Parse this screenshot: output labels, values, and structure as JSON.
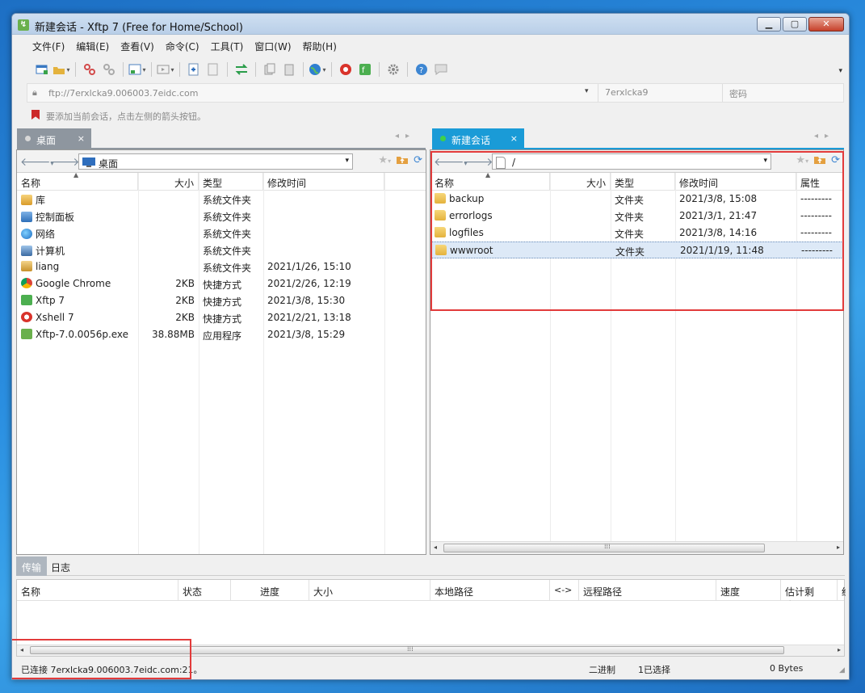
{
  "window": {
    "title": "新建会话 - Xftp 7 (Free for Home/School)",
    "minimize": "▭",
    "maximize": "▢",
    "close": "✕"
  },
  "menu": [
    "文件(F)",
    "编辑(E)",
    "查看(V)",
    "命令(C)",
    "工具(T)",
    "窗口(W)",
    "帮助(H)"
  ],
  "address": {
    "host": "ftp://7erxlcka9.006003.7eidc.com",
    "user": "7erxlcka9",
    "password": "密码"
  },
  "hint": "要添加当前会话，点击左侧的箭头按钮。",
  "left": {
    "tab": "桌面",
    "path": "桌面",
    "columns": [
      "名称",
      "大小",
      "类型",
      "修改时间"
    ],
    "rows": [
      {
        "icon": "library-icon",
        "name": "库",
        "size": "",
        "type": "系统文件夹",
        "modified": ""
      },
      {
        "icon": "control-panel-icon",
        "name": "控制面板",
        "size": "",
        "type": "系统文件夹",
        "modified": ""
      },
      {
        "icon": "network-icon",
        "name": "网络",
        "size": "",
        "type": "系统文件夹",
        "modified": ""
      },
      {
        "icon": "computer-icon",
        "name": "计算机",
        "size": "",
        "type": "系统文件夹",
        "modified": ""
      },
      {
        "icon": "user-folder-icon",
        "name": "liang",
        "size": "",
        "type": "系统文件夹",
        "modified": "2021/1/26, 15:10"
      },
      {
        "icon": "chrome-icon",
        "name": "Google Chrome",
        "size": "2KB",
        "type": "快捷方式",
        "modified": "2021/2/26, 12:19"
      },
      {
        "icon": "xftp-icon",
        "name": "Xftp 7",
        "size": "2KB",
        "type": "快捷方式",
        "modified": "2021/3/8, 15:30"
      },
      {
        "icon": "xshell-icon",
        "name": "Xshell 7",
        "size": "2KB",
        "type": "快捷方式",
        "modified": "2021/2/21, 13:18"
      },
      {
        "icon": "exe-icon",
        "name": "Xftp-7.0.0056p.exe",
        "size": "38.88MB",
        "type": "应用程序",
        "modified": "2021/3/8, 15:29"
      }
    ]
  },
  "right": {
    "tab": "新建会话",
    "path": "/",
    "columns": [
      "名称",
      "大小",
      "类型",
      "修改时间",
      "属性"
    ],
    "rows": [
      {
        "name": "backup",
        "size": "",
        "type": "文件夹",
        "modified": "2021/3/8, 15:08",
        "attr": "---------"
      },
      {
        "name": "errorlogs",
        "size": "",
        "type": "文件夹",
        "modified": "2021/3/1, 21:47",
        "attr": "---------"
      },
      {
        "name": "logfiles",
        "size": "",
        "type": "文件夹",
        "modified": "2021/3/8, 14:16",
        "attr": "---------"
      },
      {
        "name": "wwwroot",
        "size": "",
        "type": "文件夹",
        "modified": "2021/1/19, 11:48",
        "attr": "---------"
      }
    ],
    "selected_index": 3
  },
  "bottom_tabs": [
    "传输",
    "日志"
  ],
  "transfer_columns": [
    "名称",
    "状态",
    "进度",
    "大小",
    "本地路径",
    "<->",
    "远程路径",
    "速度",
    "估计剩余...",
    "经"
  ],
  "status": {
    "connection": "已连接 7erxlcka9.006003.7eidc.com:21。",
    "mode": "二进制",
    "selection": "1已选择",
    "bytes": "0 Bytes"
  },
  "colors": {
    "accent": "#1a9bd7",
    "highlight": "#e23b3b",
    "inactive_tab": "#8e969f"
  }
}
